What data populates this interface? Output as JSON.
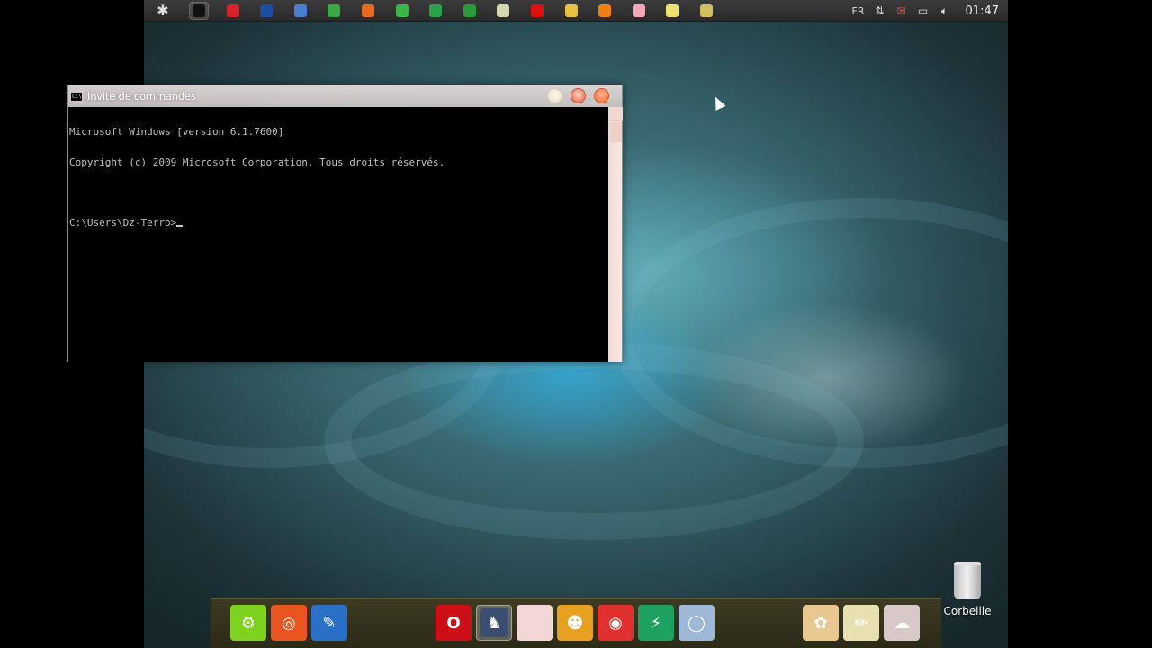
{
  "top_panel": {
    "launchers": [
      {
        "icon": "terminal-icon",
        "color": "#111111",
        "active": true
      },
      {
        "icon": "record-icon",
        "color": "#d8232a"
      },
      {
        "icon": "virtualbox-icon",
        "color": "#1e4ca0"
      },
      {
        "icon": "shield-icon",
        "color": "#4a7fd0"
      },
      {
        "icon": "chrome-icon",
        "color": "#3aa845"
      },
      {
        "icon": "firefox-icon",
        "color": "#e66a1f"
      },
      {
        "icon": "green-globe-icon",
        "color": "#3ab54a"
      },
      {
        "icon": "network-icon",
        "color": "#2aa04a"
      },
      {
        "icon": "spreadsheet-icon",
        "color": "#2a9a3a"
      },
      {
        "icon": "pencil-note-icon",
        "color": "#d8d8b0"
      },
      {
        "icon": "youtube-icon",
        "color": "#e01010"
      },
      {
        "icon": "folder-icon",
        "color": "#e8c040"
      },
      {
        "icon": "vlc-icon",
        "color": "#f08010"
      },
      {
        "icon": "pig-icon",
        "color": "#f0a8b8"
      },
      {
        "icon": "sticky-note-icon",
        "color": "#f0e070"
      },
      {
        "icon": "tools-icon",
        "color": "#d0c060"
      }
    ],
    "tray": {
      "keyboard_layout": "FR",
      "clock": "01:47"
    }
  },
  "window": {
    "title": "Invite de commandes",
    "console_lines": [
      "Microsoft Windows [version 6.1.7600]",
      "Copyright (c) 2009 Microsoft Corporation. Tous droits réservés.",
      "",
      "C:\\Users\\Dz-Terro>"
    ]
  },
  "desktop": {
    "trash_label": "Corbeille"
  },
  "dock": {
    "items": [
      {
        "icon": "settings-icon",
        "color": "#7ed321",
        "glyph": "⚙"
      },
      {
        "icon": "ubuntu-icon",
        "color": "#e95420",
        "glyph": "◎"
      },
      {
        "icon": "text-editor-icon",
        "color": "#2a6fc8",
        "glyph": "✎"
      },
      {
        "icon": "opera-icon",
        "color": "#cc0f16",
        "glyph": "O"
      },
      {
        "icon": "counter-strike-icon",
        "color": "#3b4d70",
        "glyph": "♞",
        "active": true
      },
      {
        "icon": "blank-app-icon",
        "color": "#f3d6d6",
        "glyph": ""
      },
      {
        "icon": "people-icon",
        "color": "#e8a020",
        "glyph": "☻"
      },
      {
        "icon": "media-icon",
        "color": "#e03030",
        "glyph": "◉"
      },
      {
        "icon": "lightning-app-icon",
        "color": "#1ea060",
        "glyph": "⚡"
      },
      {
        "icon": "globe-pro-icon",
        "color": "#9fb8d8",
        "glyph": "◯"
      },
      {
        "icon": "paint-palette-icon",
        "color": "#e8c890",
        "glyph": "✿"
      },
      {
        "icon": "notepad-icon",
        "color": "#e8e0b0",
        "glyph": "✏"
      },
      {
        "icon": "weather-app-icon",
        "color": "#d8c8c8",
        "glyph": "☁"
      }
    ]
  }
}
